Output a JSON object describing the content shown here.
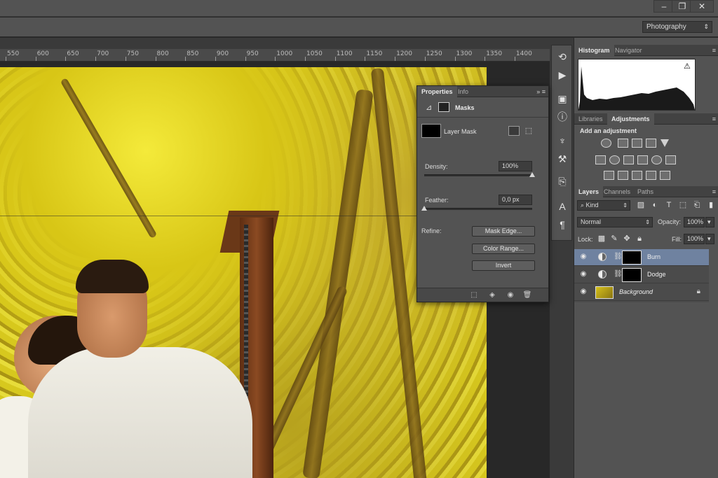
{
  "window": {
    "minimize_glyph": "–",
    "restore_glyph": "❐",
    "close_glyph": "✕"
  },
  "workspace": {
    "selected": "Photography"
  },
  "ruler": {
    "ticks": [
      "550",
      "600",
      "650",
      "700",
      "750",
      "800",
      "850",
      "900",
      "950",
      "1000",
      "1050",
      "1100",
      "1150",
      "1200",
      "1250",
      "1300",
      "1350",
      "1400"
    ]
  },
  "panels_top": {
    "histogram_tab": "Histogram",
    "navigator_tab": "Navigator",
    "warning_glyph": "⚠"
  },
  "panels_adjust": {
    "libraries_tab": "Libraries",
    "adjustments_tab": "Adjustments",
    "add_label": "Add an adjustment"
  },
  "layers_panel": {
    "layers_tab": "Layers",
    "channels_tab": "Channels",
    "paths_tab": "Paths",
    "kind_filter": "Kind",
    "blend_mode": "Normal",
    "opacity_label": "Opacity:",
    "opacity_value": "100%",
    "lock_label": "Lock:",
    "fill_label": "Fill:",
    "fill_value": "100%",
    "layers": [
      {
        "name": "Burn"
      },
      {
        "name": "Dodge"
      },
      {
        "name": "Background"
      }
    ]
  },
  "properties": {
    "properties_tab": "Properties",
    "info_tab": "Info",
    "masks_title": "Masks",
    "layer_mask_label": "Layer Mask",
    "density_label": "Density:",
    "density_value": "100%",
    "density_level": 1.0,
    "feather_label": "Feather:",
    "feather_value": "0,0 px",
    "feather_level": 0.0,
    "refine_label": "Refine:",
    "mask_edge_button": "Mask Edge...",
    "color_range_button": "Color Range...",
    "invert_button": "Invert"
  },
  "colors": {
    "panel_bg": "#535353",
    "selected_layer": "#6f82a0"
  }
}
